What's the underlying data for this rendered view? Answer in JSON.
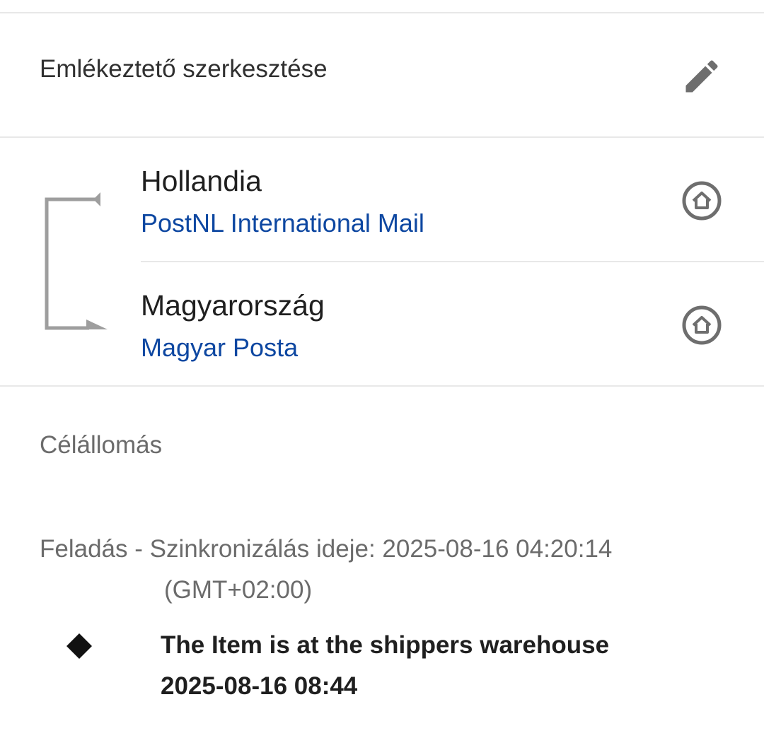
{
  "reminder": {
    "label": "Emlékeztető szerkesztése",
    "icon": "pencil-icon"
  },
  "route": {
    "origin": {
      "country": "Hollandia",
      "carrier": "PostNL International Mail",
      "icon": "home-icon"
    },
    "destination": {
      "country": "Magyarország",
      "carrier": "Magyar Posta",
      "icon": "home-icon"
    }
  },
  "destination_section": {
    "label": "Célállomás"
  },
  "tracking": {
    "sync_line": "Feladás - Szinkronizálás ideje: 2025-08-16 04:20:14 (GMT+02:00)",
    "events": [
      {
        "description": "The Item is at the shippers warehouse",
        "time": "2025-08-16 08:44"
      }
    ]
  },
  "colors": {
    "carrier_link": "#0d47a1",
    "icon_gray": "#6e6e6e",
    "divider": "#e8e8e8"
  }
}
